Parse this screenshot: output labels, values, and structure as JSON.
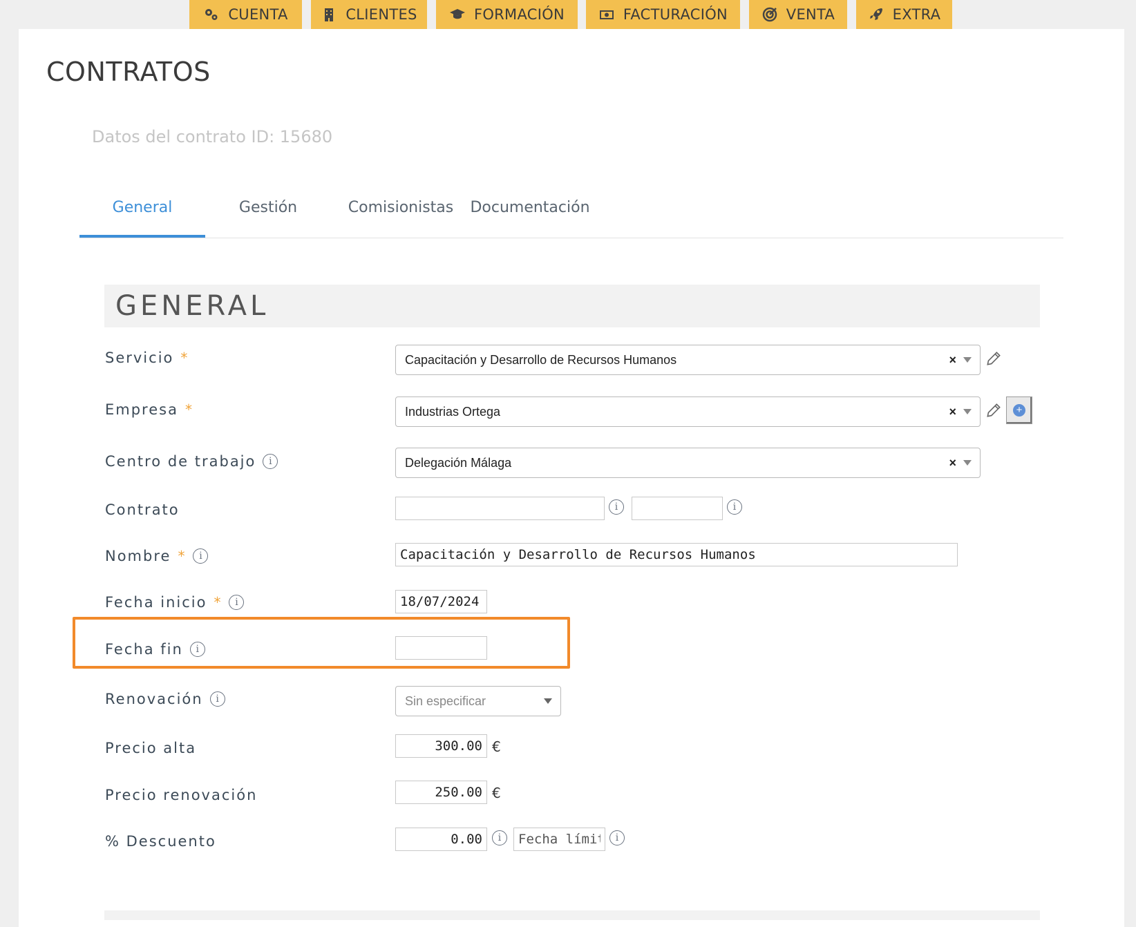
{
  "nav": {
    "tabs": [
      {
        "label": "CUENTA",
        "icon": "gears-icon"
      },
      {
        "label": "CLIENTES",
        "icon": "building-icon"
      },
      {
        "label": "FORMACIÓN",
        "icon": "graduation-cap-icon"
      },
      {
        "label": "FACTURACIÓN",
        "icon": "money-bill-icon"
      },
      {
        "label": "VENTA",
        "icon": "target-icon"
      },
      {
        "label": "EXTRA",
        "icon": "rocket-icon"
      }
    ]
  },
  "page": {
    "title": "CONTRATOS",
    "subtitle": "Datos del contrato ID: 15680"
  },
  "tabs": [
    {
      "label": "General",
      "active": true
    },
    {
      "label": "Gestión"
    },
    {
      "label": "Comisionistas"
    },
    {
      "label": "Documentación"
    }
  ],
  "section": {
    "title": "GENERAL"
  },
  "form": {
    "servicio": {
      "label": "Servicio",
      "value": "Capacitación y Desarrollo de Recursos Humanos",
      "clear": "×"
    },
    "empresa": {
      "label": "Empresa",
      "value": "Industrias Ortega",
      "clear": "×",
      "add": "+"
    },
    "centro": {
      "label": "Centro de trabajo",
      "value": "Delegación Málaga",
      "clear": "×"
    },
    "contrato": {
      "label": "Contrato",
      "value1": "",
      "value2": ""
    },
    "nombre": {
      "label": "Nombre",
      "value": "Capacitación y Desarrollo de Recursos Humanos"
    },
    "fecha_inicio": {
      "label": "Fecha inicio",
      "value": "18/07/2024"
    },
    "fecha_fin": {
      "label": "Fecha fin",
      "value": ""
    },
    "renovacion": {
      "label": "Renovación",
      "value": "Sin especificar"
    },
    "precio_alta": {
      "label": "Precio alta",
      "value": "300.00",
      "currency": "€"
    },
    "precio_renovacion": {
      "label": "Precio renovación",
      "value": "250.00",
      "currency": "€"
    },
    "descuento": {
      "label": "% Descuento",
      "value": "0.00",
      "fecha_limite_placeholder": "Fecha límite"
    },
    "required_mark": "*",
    "info_glyph": "i"
  },
  "colors": {
    "nav_tab": "#f3bf4f",
    "active_tab": "#3d8fd8",
    "highlight": "#f28a2b",
    "required": "#f0a43b"
  }
}
